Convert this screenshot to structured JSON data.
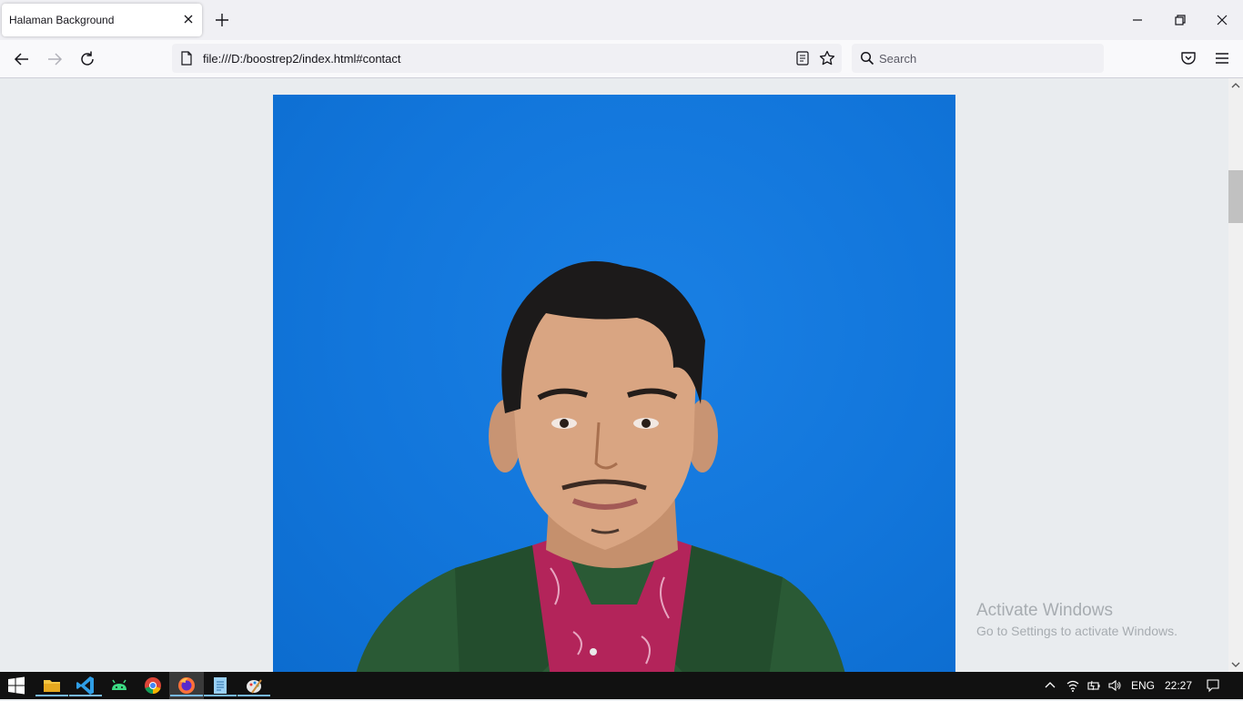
{
  "tab": {
    "title": "Halaman Background"
  },
  "urlbar": {
    "url": "file:///D:/boostrep2/index.html#contact"
  },
  "search": {
    "placeholder": "Search"
  },
  "watermark": {
    "title": "Activate Windows",
    "subtitle": "Go to Settings to activate Windows."
  },
  "tray": {
    "language": "ENG",
    "time": "22:27"
  },
  "taskbar": {
    "apps": [
      "windows-start",
      "file-explorer",
      "vscode",
      "android-studio",
      "chrome",
      "firefox",
      "notepad",
      "paint"
    ],
    "active_app": "firefox"
  },
  "colors": {
    "photo_background": "#1276db",
    "jacket": "#2a5a35",
    "shirt": "#b3245a",
    "page_background": "#e9ecef"
  }
}
